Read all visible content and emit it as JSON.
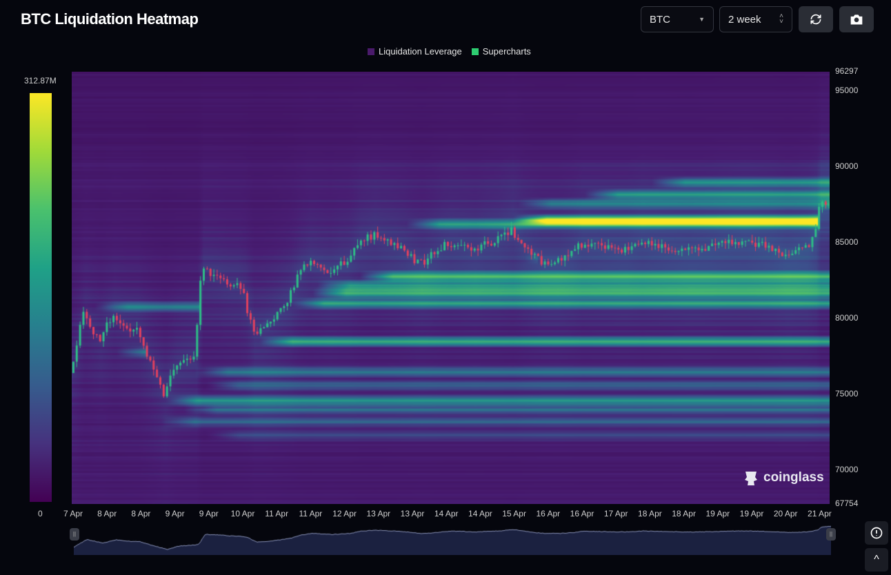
{
  "header": {
    "title": "BTC Liquidation Heatmap",
    "symbol_select": "BTC",
    "range_select": "2 week",
    "refresh_icon": "refresh-icon",
    "camera_icon": "camera-icon"
  },
  "legend": [
    {
      "label": "Liquidation Leverage",
      "color": "#4a1a6b"
    },
    {
      "label": "Supercharts",
      "color": "#2ecc71"
    }
  ],
  "colorbar": {
    "max_label": "312.87M",
    "min_label": "0"
  },
  "watermark": "coinglass",
  "chart_data": {
    "type": "heatmap",
    "title": "BTC Liquidation Heatmap",
    "ylim": [
      67754,
      96297
    ],
    "y_ticks": [
      "96297",
      "95000",
      "90000",
      "85000",
      "80000",
      "75000",
      "70000",
      "67754"
    ],
    "y_tick_values": [
      96297,
      95000,
      90000,
      85000,
      80000,
      75000,
      70000,
      67754
    ],
    "x_ticks": [
      "7 Apr",
      "8 Apr",
      "8 Apr",
      "9 Apr",
      "9 Apr",
      "10 Apr",
      "11 Apr",
      "11 Apr",
      "12 Apr",
      "13 Apr",
      "13 Apr",
      "14 Apr",
      "14 Apr",
      "15 Apr",
      "16 Apr",
      "16 Apr",
      "17 Apr",
      "18 Apr",
      "18 Apr",
      "19 Apr",
      "19 Apr",
      "20 Apr",
      "21 Apr"
    ],
    "x_range_hours": [
      0,
      340
    ],
    "colorscale_max": 312.87,
    "price_series": [
      [
        0,
        76400
      ],
      [
        6,
        80400
      ],
      [
        13,
        78500
      ],
      [
        19,
        80300
      ],
      [
        25,
        79500
      ],
      [
        30,
        79200
      ],
      [
        36,
        77000
      ],
      [
        42,
        75000
      ],
      [
        47,
        76800
      ],
      [
        51,
        77200
      ],
      [
        56,
        77600
      ],
      [
        59,
        83200
      ],
      [
        65,
        82900
      ],
      [
        70,
        82400
      ],
      [
        75,
        82200
      ],
      [
        78,
        81500
      ],
      [
        82,
        79100
      ],
      [
        86,
        79300
      ],
      [
        90,
        79800
      ],
      [
        94,
        80500
      ],
      [
        98,
        81300
      ],
      [
        102,
        82800
      ],
      [
        107,
        83800
      ],
      [
        112,
        83400
      ],
      [
        116,
        83100
      ],
      [
        120,
        83500
      ],
      [
        124,
        83700
      ],
      [
        129,
        85000
      ],
      [
        136,
        85500
      ],
      [
        140,
        85200
      ],
      [
        144,
        85000
      ],
      [
        149,
        84600
      ],
      [
        153,
        84000
      ],
      [
        157,
        83600
      ],
      [
        160,
        83900
      ],
      [
        166,
        84700
      ],
      [
        170,
        85000
      ],
      [
        175,
        84800
      ],
      [
        181,
        84500
      ],
      [
        186,
        84900
      ],
      [
        191,
        85100
      ],
      [
        198,
        85800
      ],
      [
        203,
        84800
      ],
      [
        207,
        84200
      ],
      [
        211,
        83800
      ],
      [
        218,
        83700
      ],
      [
        222,
        84000
      ],
      [
        225,
        84300
      ],
      [
        229,
        84900
      ],
      [
        235,
        84800
      ],
      [
        240,
        84700
      ],
      [
        245,
        84600
      ],
      [
        249,
        84600
      ],
      [
        256,
        85100
      ],
      [
        260,
        84900
      ],
      [
        265,
        84800
      ],
      [
        272,
        84600
      ],
      [
        277,
        84500
      ],
      [
        283,
        84600
      ],
      [
        287,
        84700
      ],
      [
        292,
        84900
      ],
      [
        296,
        85000
      ],
      [
        302,
        85100
      ],
      [
        308,
        84900
      ],
      [
        314,
        84700
      ],
      [
        321,
        84200
      ],
      [
        326,
        84400
      ],
      [
        330,
        84600
      ],
      [
        334,
        85500
      ],
      [
        336,
        87400
      ],
      [
        340,
        87600
      ]
    ],
    "liquidity_bands": [
      {
        "price": 86500,
        "start": 198,
        "intensity": 0.95
      },
      {
        "price": 86250,
        "start": 150,
        "intensity": 0.45
      },
      {
        "price": 89000,
        "start": 260,
        "intensity": 0.4
      },
      {
        "price": 88200,
        "start": 230,
        "intensity": 0.45
      },
      {
        "price": 87600,
        "start": 200,
        "intensity": 0.35
      },
      {
        "price": 82800,
        "start": 129,
        "intensity": 0.6
      },
      {
        "price": 82200,
        "start": 110,
        "intensity": 0.45
      },
      {
        "price": 81700,
        "start": 108,
        "intensity": 0.55
      },
      {
        "price": 81000,
        "start": 98,
        "intensity": 0.5
      },
      {
        "price": 80800,
        "start": 10,
        "intensity": 0.4
      },
      {
        "price": 79600,
        "start": 85,
        "intensity": 0.4
      },
      {
        "price": 78500,
        "start": 84,
        "intensity": 0.55
      },
      {
        "price": 77800,
        "start": 20,
        "intensity": 0.35
      },
      {
        "price": 76500,
        "start": 55,
        "intensity": 0.35
      },
      {
        "price": 75600,
        "start": 60,
        "intensity": 0.3
      },
      {
        "price": 74600,
        "start": 42,
        "intensity": 0.5
      },
      {
        "price": 74000,
        "start": 50,
        "intensity": 0.35
      },
      {
        "price": 73200,
        "start": 40,
        "intensity": 0.3
      },
      {
        "price": 72300,
        "start": 60,
        "intensity": 0.2
      },
      {
        "price": 84000,
        "start": 203,
        "intensity": 0.3
      }
    ]
  }
}
